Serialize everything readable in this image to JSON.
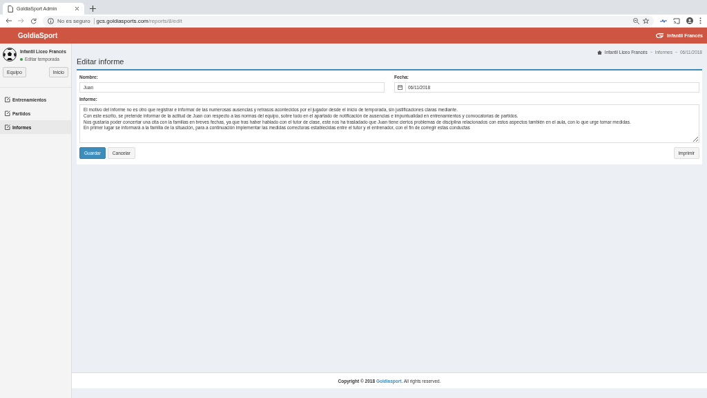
{
  "browser": {
    "tab_title": "GoldiaSport Admin",
    "security": "No es seguro",
    "url_host": "gcs.goldiasports.com",
    "url_path": "/reports/8/edit"
  },
  "header": {
    "brand": "GoldiaSport",
    "team": "Infantil Francés"
  },
  "sidebar": {
    "team_name": "Infantil Liceo Francés",
    "status": "Editar temporada",
    "buttons": [
      "Equipo",
      "Inicio"
    ],
    "items": [
      {
        "label": "Entrenamientos",
        "selected": false
      },
      {
        "label": "Partidos",
        "selected": false
      },
      {
        "label": "Informes",
        "selected": true
      }
    ]
  },
  "breadcrumb": [
    "Infantil Liceo Francés",
    "Informes",
    "06/11/2018"
  ],
  "page_title": "Editar informe",
  "form": {
    "name_label": "Nombre:",
    "name_value": "Juan",
    "date_label": "Fecha:",
    "date_value": "06/11/2018",
    "report_label": "Informe:",
    "report_lines": [
      "El motivo del informe no es otro que registrar e informar de las numerosas ausencias y retrasos acontecidos por el jugador desde el inicio de temporada, sin justificaciones claras mediante.",
      "Con este escrito, se pretende informar de la actitud de Juan con respecto a las normas del equipo, sobre todo en el apartado de notificación de ausencias e impuntualidad en entrenamientos y convocatorias de partidos.",
      "Nos gustaría poder concertar una cita con la familias en breves fechas, ya que tras haber hablado con el tutor de clase, este nos ha trasladado que Juan tiene ciertos problemas de disciplina relacionados con estos aspectos también en el aula, con lo que urge tomar medidas.",
      "En primer lugar se informará a la familia de la situación, para a continuación implementar las medidas correctoras establecidas entre el tutor y el entrenador, con el fin de corregir estas conductas"
    ],
    "save": "Guardar",
    "cancel": "Cancelar",
    "print": "Imprimir"
  },
  "footer": {
    "prefix": "Copyright © 2018",
    "link": "Goldiasport",
    "suffix": ". All rights reserved."
  }
}
